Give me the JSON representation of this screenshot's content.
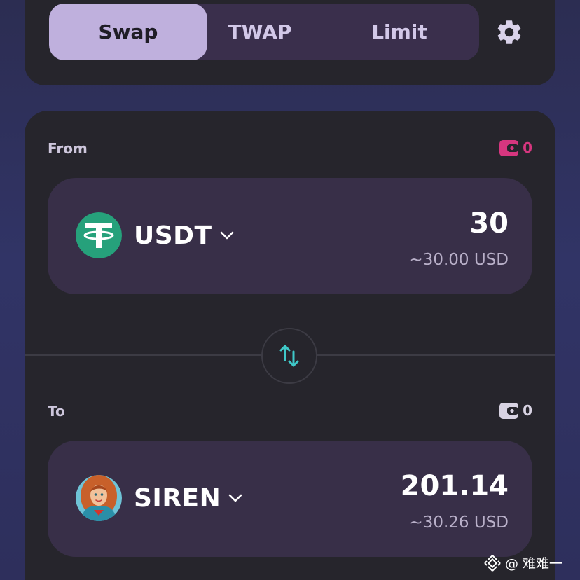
{
  "tabs": {
    "swap": "Swap",
    "twap": "TWAP",
    "limit": "Limit"
  },
  "settings_icon": "gear-icon",
  "from": {
    "label": "From",
    "balance": "0",
    "balance_color": "#d6367f",
    "token_symbol": "USDT",
    "amount": "30",
    "usd_value": "~30.00 USD"
  },
  "to": {
    "label": "To",
    "balance": "0",
    "balance_color": "#d8d3e3",
    "token_symbol": "SIREN",
    "amount": "201.14",
    "usd_value": "~30.26 USD"
  },
  "switch_icon": "swap-direction-icon",
  "watermark": "@ 难难一",
  "colors": {
    "accent_tab": "#bfb0dd",
    "switch_arrows": "#3fc8c8",
    "usdt_green": "#26a17b"
  }
}
